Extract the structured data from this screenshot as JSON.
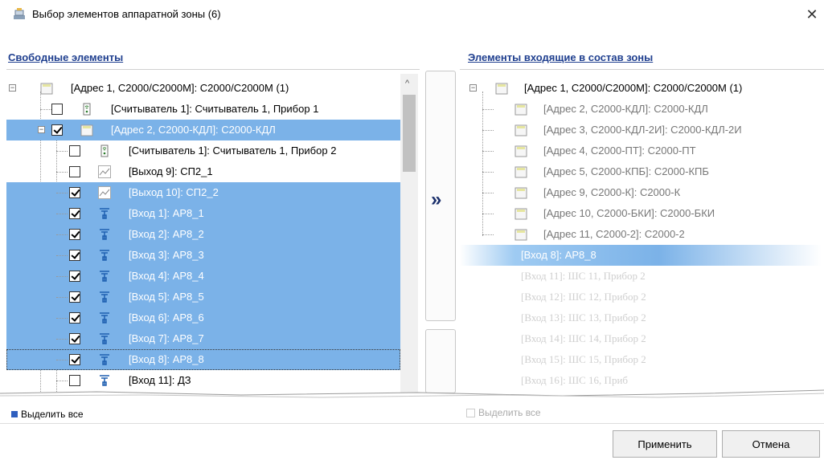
{
  "window": {
    "title": "Выбор элементов аппаратной зоны (6)",
    "close_glyph": "✕"
  },
  "left": {
    "header": "Свободные элементы",
    "rows": [
      {
        "label": "[Адрес 1, С2000/С2000М]: С2000/С2000М (1)",
        "icon": "device-icon"
      },
      {
        "label": "[Считыватель 1]: Считыватель 1, Прибор 1",
        "icon": "reader-icon",
        "checked": false
      },
      {
        "label": "[Адрес 2, С2000-КДЛ]: С2000-КДЛ",
        "icon": "device-icon",
        "checked": true
      },
      {
        "label": "[Считыватель 1]: Считыватель 1, Прибор 2",
        "icon": "reader-icon",
        "checked": false
      },
      {
        "label": "[Выход 9]: СП2_1",
        "icon": "output-icon",
        "checked": false
      },
      {
        "label": "[Выход 10]: СП2_2",
        "icon": "output-icon",
        "checked": true
      },
      {
        "label": "[Вход 1]: АР8_1",
        "icon": "input-icon",
        "checked": true
      },
      {
        "label": "[Вход 2]: АР8_2",
        "icon": "input-icon",
        "checked": true
      },
      {
        "label": "[Вход 3]: АР8_3",
        "icon": "input-icon",
        "checked": true
      },
      {
        "label": "[Вход 4]: АР8_4",
        "icon": "input-icon",
        "checked": true
      },
      {
        "label": "[Вход 5]: АР8_5",
        "icon": "input-icon",
        "checked": true
      },
      {
        "label": "[Вход 6]: АР8_6",
        "icon": "input-icon",
        "checked": true
      },
      {
        "label": "[Вход 7]: АР8_7",
        "icon": "input-icon",
        "checked": true
      },
      {
        "label": "[Вход 8]: АР8_8",
        "icon": "input-icon",
        "checked": true
      },
      {
        "label": "[Вход 11]: ДЗ",
        "icon": "input-icon",
        "checked": false
      }
    ],
    "select_all": "Выделить все"
  },
  "middle": {
    "move_glyph": "»"
  },
  "right": {
    "header": "Элементы входящие в состав зоны",
    "rows": [
      {
        "label": "[Адрес 1, С2000/С2000М]: С2000/С2000М (1)"
      },
      {
        "label": "[Адрес 2, С2000-КДЛ]: С2000-КДЛ"
      },
      {
        "label": "[Адрес 3, С2000-КДЛ-2И]: С2000-КДЛ-2И"
      },
      {
        "label": "[Адрес 4, С2000-ПТ]: С2000-ПТ"
      },
      {
        "label": "[Адрес 5, С2000-КПБ]: С2000-КПБ"
      },
      {
        "label": "[Адрес 9, С2000-К]: С2000-К"
      },
      {
        "label": "[Адрес 10, С2000-БКИ]: С2000-БКИ"
      },
      {
        "label": "[Адрес 11, С2000-2]: С2000-2"
      },
      {
        "label": "[Вход 8]: АР8_8"
      },
      {
        "label": "[Вход 11]: ШС 11, Прибор 2"
      },
      {
        "label": "[Вход 12]: ШС 12, Прибор 2"
      },
      {
        "label": "[Вход 13]: ШС 13, Прибор 2"
      },
      {
        "label": "[Вход 14]: ШС 14, Прибор 2"
      },
      {
        "label": "[Вход 15]: ШС 15, Прибор 2"
      },
      {
        "label": "[Вход 16]: ШС 16, Приб"
      }
    ],
    "select_all": "Выделить все"
  },
  "buttons": {
    "apply": "Применить",
    "cancel": "Отмена"
  }
}
